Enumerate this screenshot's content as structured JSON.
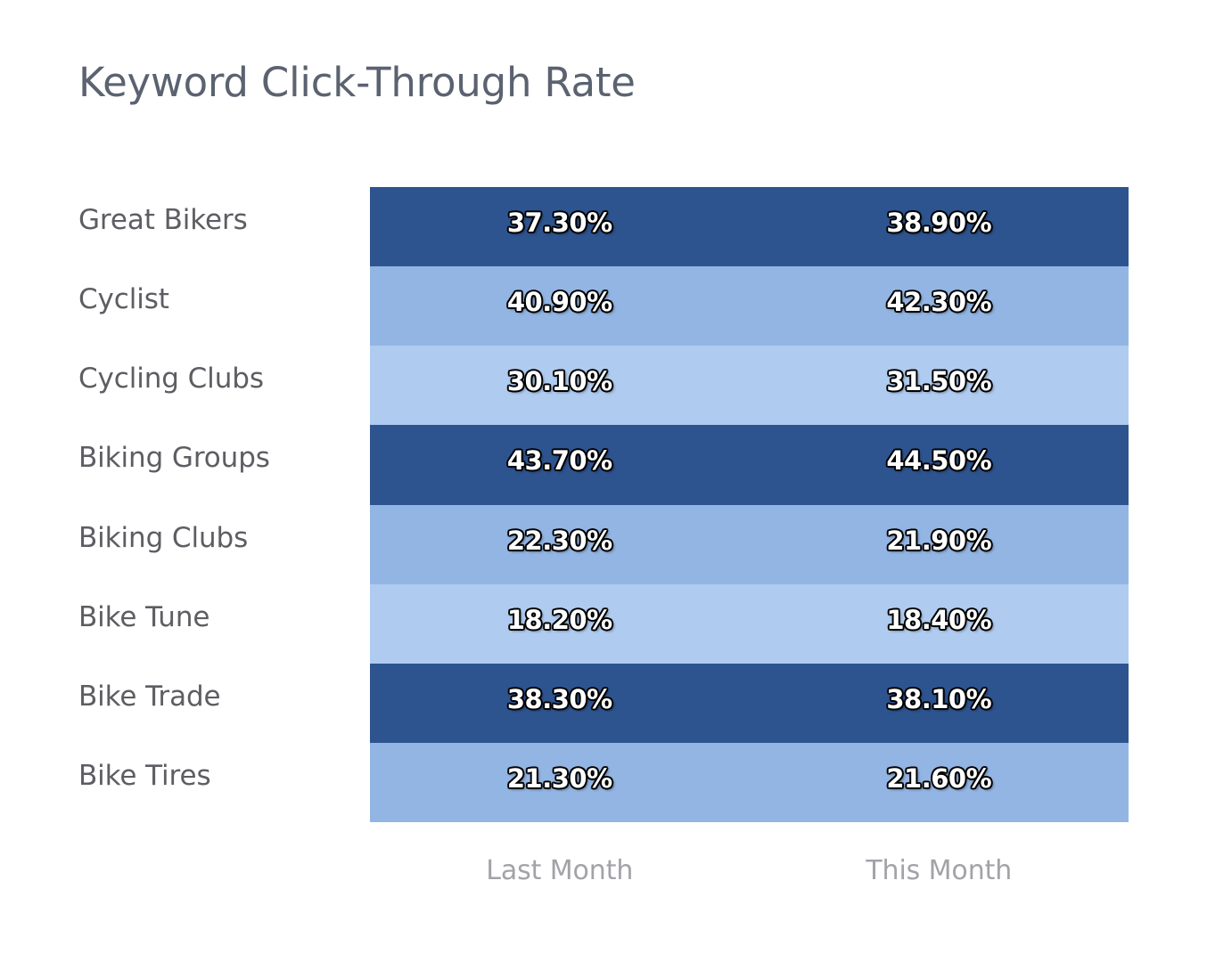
{
  "chart_data": {
    "type": "heatmap",
    "title": "Keyword Click-Through Rate",
    "xlabel": "",
    "ylabel": "",
    "grid": false,
    "legend": "none",
    "value_suffix": "%",
    "categories": [
      "Last Month",
      "This Month"
    ],
    "rows": [
      "Great Bikers",
      "Cyclist",
      "Cycling Clubs",
      "Biking Groups",
      "Biking Clubs",
      "Bike Tune",
      "Bike Trade",
      "Bike Tires"
    ],
    "series": [
      {
        "name": "Last Month",
        "values": [
          37.3,
          40.9,
          30.1,
          43.7,
          22.3,
          18.2,
          38.3,
          21.3
        ]
      },
      {
        "name": "This Month",
        "values": [
          38.9,
          42.3,
          31.5,
          44.5,
          21.9,
          18.4,
          38.1,
          21.6
        ]
      }
    ],
    "cells": [
      {
        "row": "Great Bikers",
        "last_month": "37.30%",
        "this_month": "38.90%",
        "band": "dark"
      },
      {
        "row": "Cyclist",
        "last_month": "40.90%",
        "this_month": "42.30%",
        "band": "medium"
      },
      {
        "row": "Cycling Clubs",
        "last_month": "30.10%",
        "this_month": "31.50%",
        "band": "light"
      },
      {
        "row": "Biking Groups",
        "last_month": "43.70%",
        "this_month": "44.50%",
        "band": "dark"
      },
      {
        "row": "Biking Clubs",
        "last_month": "22.30%",
        "this_month": "21.90%",
        "band": "medium"
      },
      {
        "row": "Bike Tune",
        "last_month": "18.20%",
        "this_month": "18.40%",
        "band": "light"
      },
      {
        "row": "Bike Trade",
        "last_month": "38.30%",
        "this_month": "38.10%",
        "band": "dark"
      },
      {
        "row": "Bike Tires",
        "last_month": "21.30%",
        "this_month": "21.60%",
        "band": "medium"
      }
    ],
    "colors": {
      "band_dark": "#2e5490",
      "band_medium": "#93b5e3",
      "band_light": "#b0cbf0",
      "title_text": "#5b6270",
      "row_label_text": "#5d5d63",
      "column_header_text": "#a2a2a8",
      "value_text": "#ffffff",
      "value_outline": "#000000",
      "background": "#ffffff"
    }
  }
}
